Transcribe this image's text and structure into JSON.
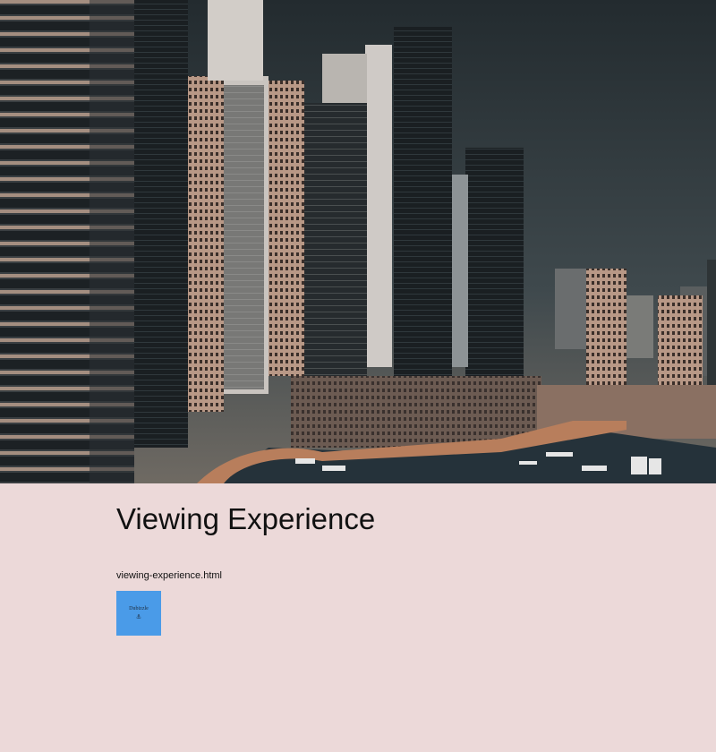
{
  "hero": {
    "image_alt": "Dubai Marina skyline"
  },
  "page": {
    "title": "Viewing Experience",
    "file_link": "viewing-experience.html"
  },
  "widget": {
    "label": "Dubizzle",
    "icon": "anchor-icon",
    "glyph": "⚓",
    "color": "#4a9be8"
  }
}
